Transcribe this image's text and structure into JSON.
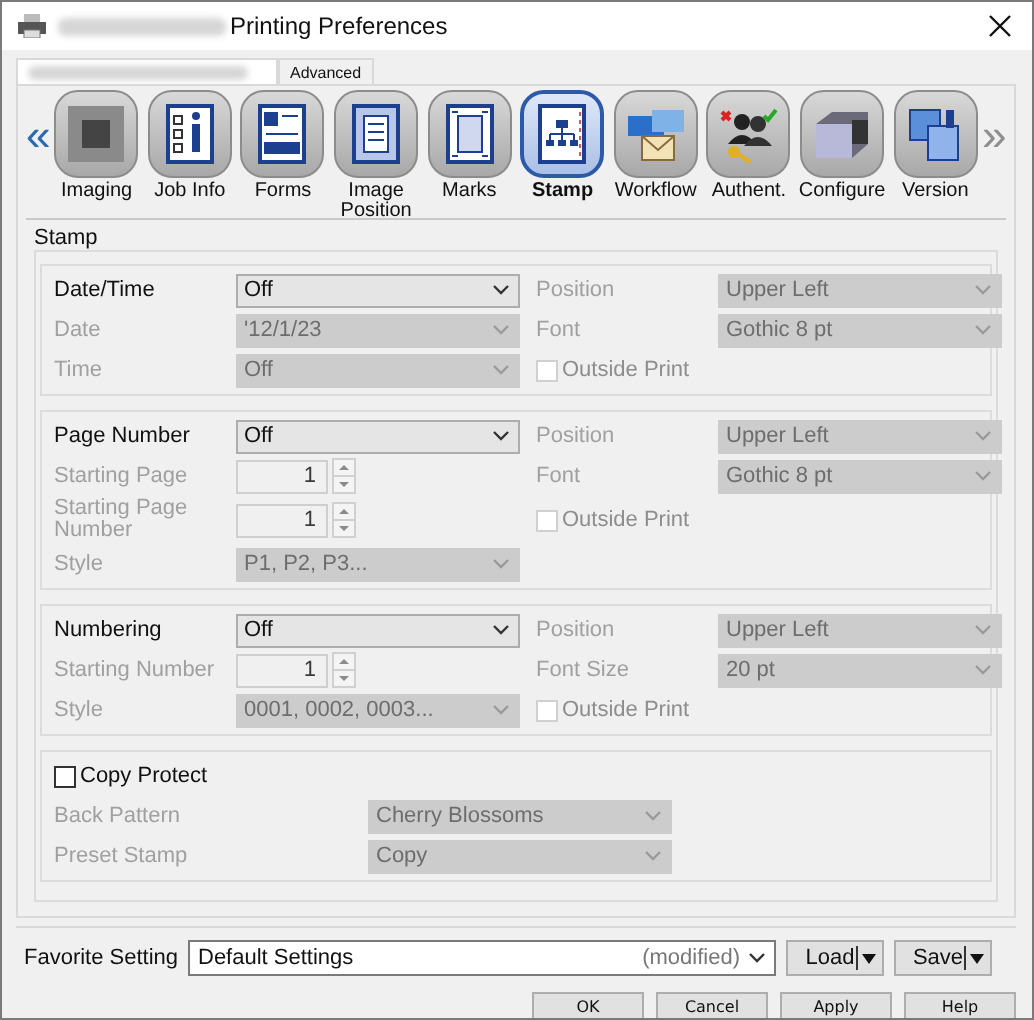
{
  "window": {
    "title": "Printing Preferences"
  },
  "tabs": [
    {
      "label": "Advanced",
      "selected": false
    }
  ],
  "toolbar": {
    "prev": "«",
    "next": "»",
    "next_disabled": true,
    "items": [
      {
        "label": "Imaging",
        "selected": false
      },
      {
        "label": "Job Info",
        "selected": false
      },
      {
        "label": "Forms",
        "selected": false
      },
      {
        "label": "Image Position",
        "selected": false
      },
      {
        "label": "Marks",
        "selected": false
      },
      {
        "label": "Stamp",
        "selected": true
      },
      {
        "label": "Workflow",
        "selected": false
      },
      {
        "label": "Authent.",
        "selected": false
      },
      {
        "label": "Configure",
        "selected": false
      },
      {
        "label": "Version",
        "selected": false
      }
    ]
  },
  "stamp": {
    "title": "Stamp",
    "groups": [
      {
        "kind": "grid",
        "rows": [
          {
            "left": {
              "label": "Date/Time",
              "disabled": false,
              "control": {
                "kind": "combo",
                "value": "Off",
                "disabled": false
              }
            },
            "right": {
              "label": "Position",
              "disabled": true,
              "control": {
                "kind": "combo",
                "value": "Upper Left",
                "disabled": true
              }
            }
          },
          {
            "left": {
              "label": "Date",
              "disabled": true,
              "control": {
                "kind": "combo",
                "value": "'12/1/23",
                "disabled": true
              }
            },
            "right": {
              "label": "Font",
              "disabled": true,
              "control": {
                "kind": "combo",
                "value": "Gothic 8 pt",
                "disabled": true
              }
            }
          },
          {
            "left": {
              "label": "Time",
              "disabled": true,
              "control": {
                "kind": "combo",
                "value": "Off",
                "disabled": true
              }
            },
            "right": {
              "control": {
                "kind": "check",
                "label": "Outside Print",
                "checked": false,
                "disabled": true
              }
            }
          }
        ]
      },
      {
        "kind": "grid",
        "rows": [
          {
            "left": {
              "label": "Page Number",
              "disabled": false,
              "control": {
                "kind": "combo",
                "value": "Off",
                "disabled": false
              }
            },
            "right": {
              "label": "Position",
              "disabled": true,
              "control": {
                "kind": "combo",
                "value": "Upper Left",
                "disabled": true
              }
            }
          },
          {
            "left": {
              "label": "Starting Page",
              "disabled": true,
              "control": {
                "kind": "spin",
                "value": "1",
                "disabled": true
              }
            },
            "right": {
              "label": "Font",
              "disabled": true,
              "control": {
                "kind": "combo",
                "value": "Gothic 8 pt",
                "disabled": true
              }
            }
          },
          {
            "left": {
              "label": "Starting Page Number",
              "disabled": true,
              "control": {
                "kind": "spin",
                "value": "1",
                "disabled": true
              }
            },
            "right": {
              "control": {
                "kind": "check",
                "label": "Outside Print",
                "checked": false,
                "disabled": true
              }
            }
          },
          {
            "left": {
              "label": "Style",
              "disabled": true,
              "control": {
                "kind": "combo",
                "value": "P1, P2, P3...",
                "disabled": true
              }
            }
          }
        ]
      },
      {
        "kind": "grid",
        "rows": [
          {
            "left": {
              "label": "Numbering",
              "disabled": false,
              "control": {
                "kind": "combo",
                "value": "Off",
                "disabled": false
              }
            },
            "right": {
              "label": "Position",
              "disabled": true,
              "control": {
                "kind": "combo",
                "value": "Upper Left",
                "disabled": true
              }
            }
          },
          {
            "left": {
              "label": "Starting Number",
              "disabled": true,
              "control": {
                "kind": "spin",
                "value": "1",
                "disabled": true
              }
            },
            "right": {
              "label": "Font Size",
              "disabled": true,
              "control": {
                "kind": "combo",
                "value": "20 pt",
                "disabled": true
              }
            }
          },
          {
            "left": {
              "label": "Style",
              "disabled": true,
              "control": {
                "kind": "combo",
                "value": "0001, 0002, 0003...",
                "disabled": true
              }
            },
            "right": {
              "control": {
                "kind": "check",
                "label": "Outside Print",
                "checked": false,
                "disabled": true
              }
            }
          }
        ]
      },
      {
        "kind": "check_header",
        "check": {
          "label": "Copy Protect",
          "checked": false
        },
        "rows": [
          {
            "left": {
              "label": "Back Pattern",
              "disabled": true,
              "control": {
                "kind": "combo",
                "value": "Cherry Blossoms",
                "disabled": true
              }
            }
          },
          {
            "left": {
              "label": "Preset Stamp",
              "disabled": true,
              "control": {
                "kind": "combo",
                "value": "Copy",
                "disabled": true
              }
            }
          }
        ]
      }
    ]
  },
  "favorite": {
    "label": "Favorite Setting",
    "value": "Default Settings",
    "note": "(modified)",
    "buttons": [
      "Load",
      "Save"
    ]
  },
  "buttons": [
    "OK",
    "Cancel",
    "Apply",
    "Help"
  ]
}
